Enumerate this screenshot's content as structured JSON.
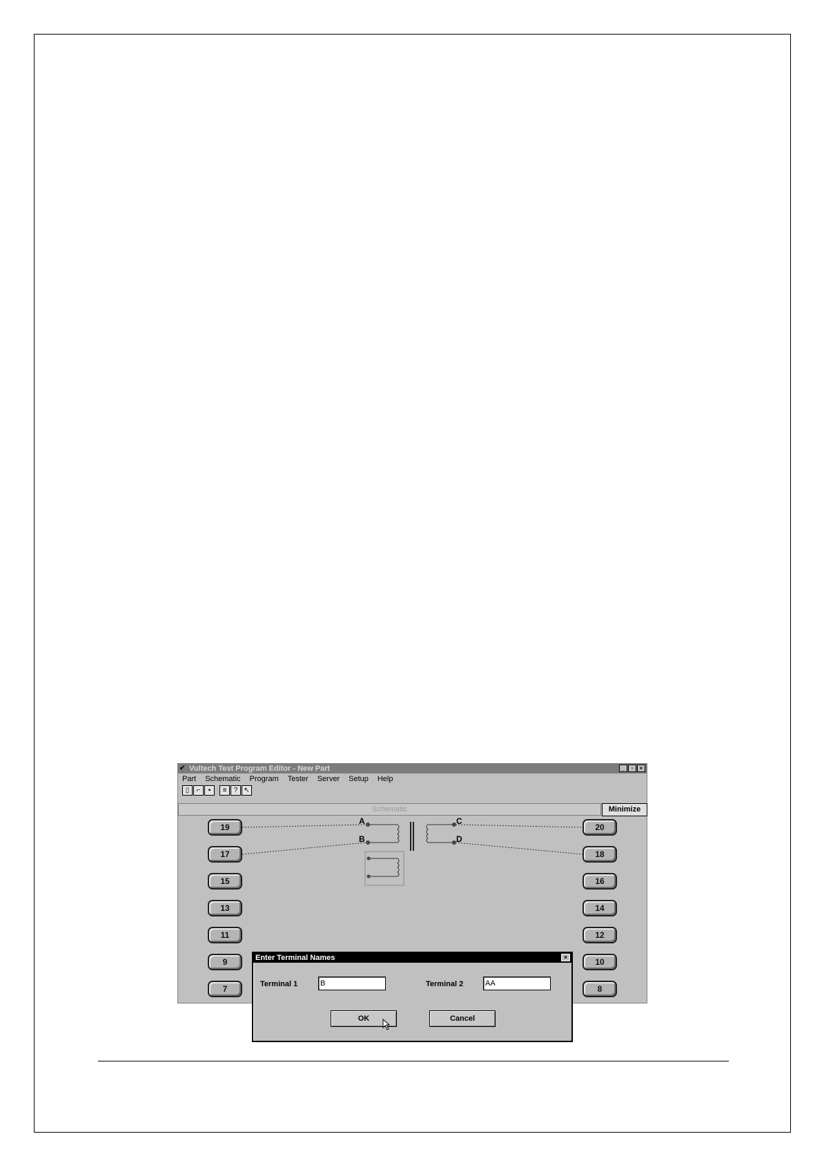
{
  "window": {
    "title": "Vultech Test Program Editor - New Part",
    "app_icon": "vultech-logo-icon",
    "controls": [
      "_",
      "̱",
      "×"
    ]
  },
  "menu": {
    "items": [
      "Part",
      "Schematic",
      "Program",
      "Tester",
      "Server",
      "Setup",
      "Help"
    ]
  },
  "toolbar": {
    "icons": [
      "new-document-icon",
      "open-folder-icon",
      "save-disk-icon",
      "print-icon",
      "help-key-icon",
      "context-help-icon"
    ]
  },
  "schematic": {
    "header": "Schematic",
    "minimize_label": "Minimize",
    "left_pins": [
      "19",
      "17",
      "15",
      "13",
      "11",
      "9",
      "7"
    ],
    "right_pins": [
      "20",
      "18",
      "16",
      "14",
      "12",
      "10",
      "8"
    ],
    "terminals": {
      "a": "A",
      "b": "B",
      "c": "C",
      "d": "D"
    }
  },
  "dialog": {
    "title": "Enter Terminal Names",
    "terminal1_label": "Terminal 1",
    "terminal1_value": "B",
    "terminal2_label": "Terminal 2",
    "terminal2_value": "AA",
    "ok_label": "OK",
    "cancel_label": "Cancel"
  }
}
